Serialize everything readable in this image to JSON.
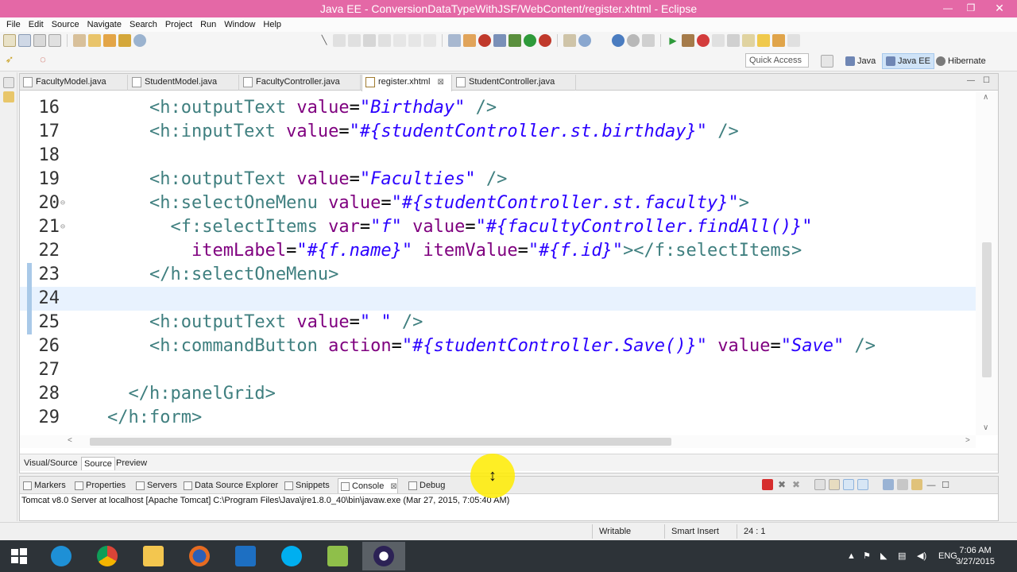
{
  "window": {
    "title": "Java EE - ConversionDataTypeWithJSF/WebContent/register.xhtml - Eclipse",
    "min_glyph": "—",
    "max_glyph": "❐",
    "close_glyph": "✕"
  },
  "menu": [
    "File",
    "Edit",
    "Source",
    "Navigate",
    "Search",
    "Project",
    "Run",
    "Window",
    "Help"
  ],
  "toolbar": {
    "quick_access_placeholder": "Quick Access",
    "perspectives": [
      "Java",
      "Java EE",
      "Hibernate"
    ],
    "active_perspective": "Java EE"
  },
  "editor": {
    "tabs": [
      {
        "label": "FacultyModel.java",
        "active": false
      },
      {
        "label": "StudentModel.java",
        "active": false
      },
      {
        "label": "FacultyController.java",
        "active": false
      },
      {
        "label": "register.xhtml",
        "active": true,
        "close": "⊠"
      },
      {
        "label": "StudentController.java",
        "active": false
      }
    ],
    "lines": [
      {
        "n": "16",
        "indent": "        ",
        "parts": [
          [
            "tag",
            "<h:outputText "
          ],
          [
            "attr",
            "value"
          ],
          [
            "eq",
            "="
          ],
          [
            "val",
            "\"Birthday\""
          ],
          [
            "tag",
            " />"
          ]
        ]
      },
      {
        "n": "17",
        "indent": "        ",
        "parts": [
          [
            "tag",
            "<h:inputText "
          ],
          [
            "attr",
            "value"
          ],
          [
            "eq",
            "="
          ],
          [
            "val",
            "\"#{studentController.st.birthday}\""
          ],
          [
            "tag",
            " />"
          ]
        ]
      },
      {
        "n": "18",
        "indent": "",
        "parts": []
      },
      {
        "n": "19",
        "indent": "        ",
        "parts": [
          [
            "tag",
            "<h:outputText "
          ],
          [
            "attr",
            "value"
          ],
          [
            "eq",
            "="
          ],
          [
            "val",
            "\"Faculties\""
          ],
          [
            "tag",
            " />"
          ]
        ]
      },
      {
        "n": "20",
        "indent": "        ",
        "fold": "⊖",
        "parts": [
          [
            "tag",
            "<h:selectOneMenu "
          ],
          [
            "attr",
            "value"
          ],
          [
            "eq",
            "="
          ],
          [
            "val",
            "\"#{studentController.st.faculty}\""
          ],
          [
            "tag",
            ">"
          ]
        ]
      },
      {
        "n": "21",
        "indent": "          ",
        "fold": "⊖",
        "parts": [
          [
            "tag",
            "<f:selectItems "
          ],
          [
            "attr",
            "var"
          ],
          [
            "eq",
            "="
          ],
          [
            "val",
            "\"f\""
          ],
          [
            "tag",
            " "
          ],
          [
            "attr",
            "value"
          ],
          [
            "eq",
            "="
          ],
          [
            "val",
            "\"#{facultyController.findAll()}\""
          ]
        ]
      },
      {
        "n": "22",
        "indent": "            ",
        "parts": [
          [
            "attr",
            "itemLabel"
          ],
          [
            "eq",
            "="
          ],
          [
            "val",
            "\"#{f.name}\""
          ],
          [
            "tag",
            " "
          ],
          [
            "attr",
            "itemValue"
          ],
          [
            "eq",
            "="
          ],
          [
            "val",
            "\"#{f.id}\""
          ],
          [
            "tag",
            "></f:selectItems>"
          ]
        ]
      },
      {
        "n": "23",
        "indent": "        ",
        "parts": [
          [
            "tag",
            "</h:selectOneMenu>"
          ]
        ]
      },
      {
        "n": "24",
        "indent": "",
        "parts": [],
        "current": true
      },
      {
        "n": "25",
        "indent": "        ",
        "parts": [
          [
            "tag",
            "<h:outputText "
          ],
          [
            "attr",
            "value"
          ],
          [
            "eq",
            "="
          ],
          [
            "val",
            "\" \""
          ],
          [
            "tag",
            " />"
          ]
        ]
      },
      {
        "n": "26",
        "indent": "        ",
        "parts": [
          [
            "tag",
            "<h:commandButton "
          ],
          [
            "attr",
            "action"
          ],
          [
            "eq",
            "="
          ],
          [
            "val",
            "\"#{studentController.Save()}\""
          ],
          [
            "tag",
            " "
          ],
          [
            "attr",
            "value"
          ],
          [
            "eq",
            "="
          ],
          [
            "val",
            "\"Save\""
          ],
          [
            "tag",
            " />"
          ]
        ]
      },
      {
        "n": "27",
        "indent": "",
        "parts": []
      },
      {
        "n": "28",
        "indent": "      ",
        "parts": [
          [
            "tag",
            "</h:panelGrid>"
          ]
        ]
      },
      {
        "n": "29",
        "indent": "    ",
        "parts": [
          [
            "tag",
            "</h:form>"
          ]
        ]
      }
    ],
    "bottom_tabs": [
      {
        "label": "Visual/Source",
        "active": false
      },
      {
        "label": "Source",
        "active": true
      },
      {
        "label": "Preview",
        "active": false
      }
    ]
  },
  "console": {
    "tabs": [
      {
        "label": "Markers",
        "active": false
      },
      {
        "label": "Properties",
        "active": false
      },
      {
        "label": "Servers",
        "active": false
      },
      {
        "label": "Data Source Explorer",
        "active": false
      },
      {
        "label": "Snippets",
        "active": false
      },
      {
        "label": "Console",
        "active": true,
        "close": "⊠"
      },
      {
        "label": "Debug",
        "active": false
      }
    ],
    "line": "Tomcat v8.0 Server at localhost [Apache Tomcat] C:\\Program Files\\Java\\jre1.8.0_40\\bin\\javaw.exe (Mar 27, 2015, 7:05:40 AM)"
  },
  "status": {
    "writable": "Writable",
    "insert_mode": "Smart Insert",
    "position": "24 : 1"
  },
  "taskbar": {
    "apps": [
      "windows-start",
      "internet-explorer",
      "chrome",
      "file-explorer",
      "firefox",
      "outlook",
      "skype",
      "notepad-plus",
      "eclipse"
    ],
    "lang": "ENG",
    "time": "7:06 AM",
    "date": "3/27/2015"
  },
  "colors": {
    "titlebar": "#e468a6",
    "tag": "#3f7f7f",
    "attribute": "#7f007f",
    "value": "#2a00ff",
    "current_line": "#e8f2fe",
    "cursor_highlight": "#ffec00"
  }
}
